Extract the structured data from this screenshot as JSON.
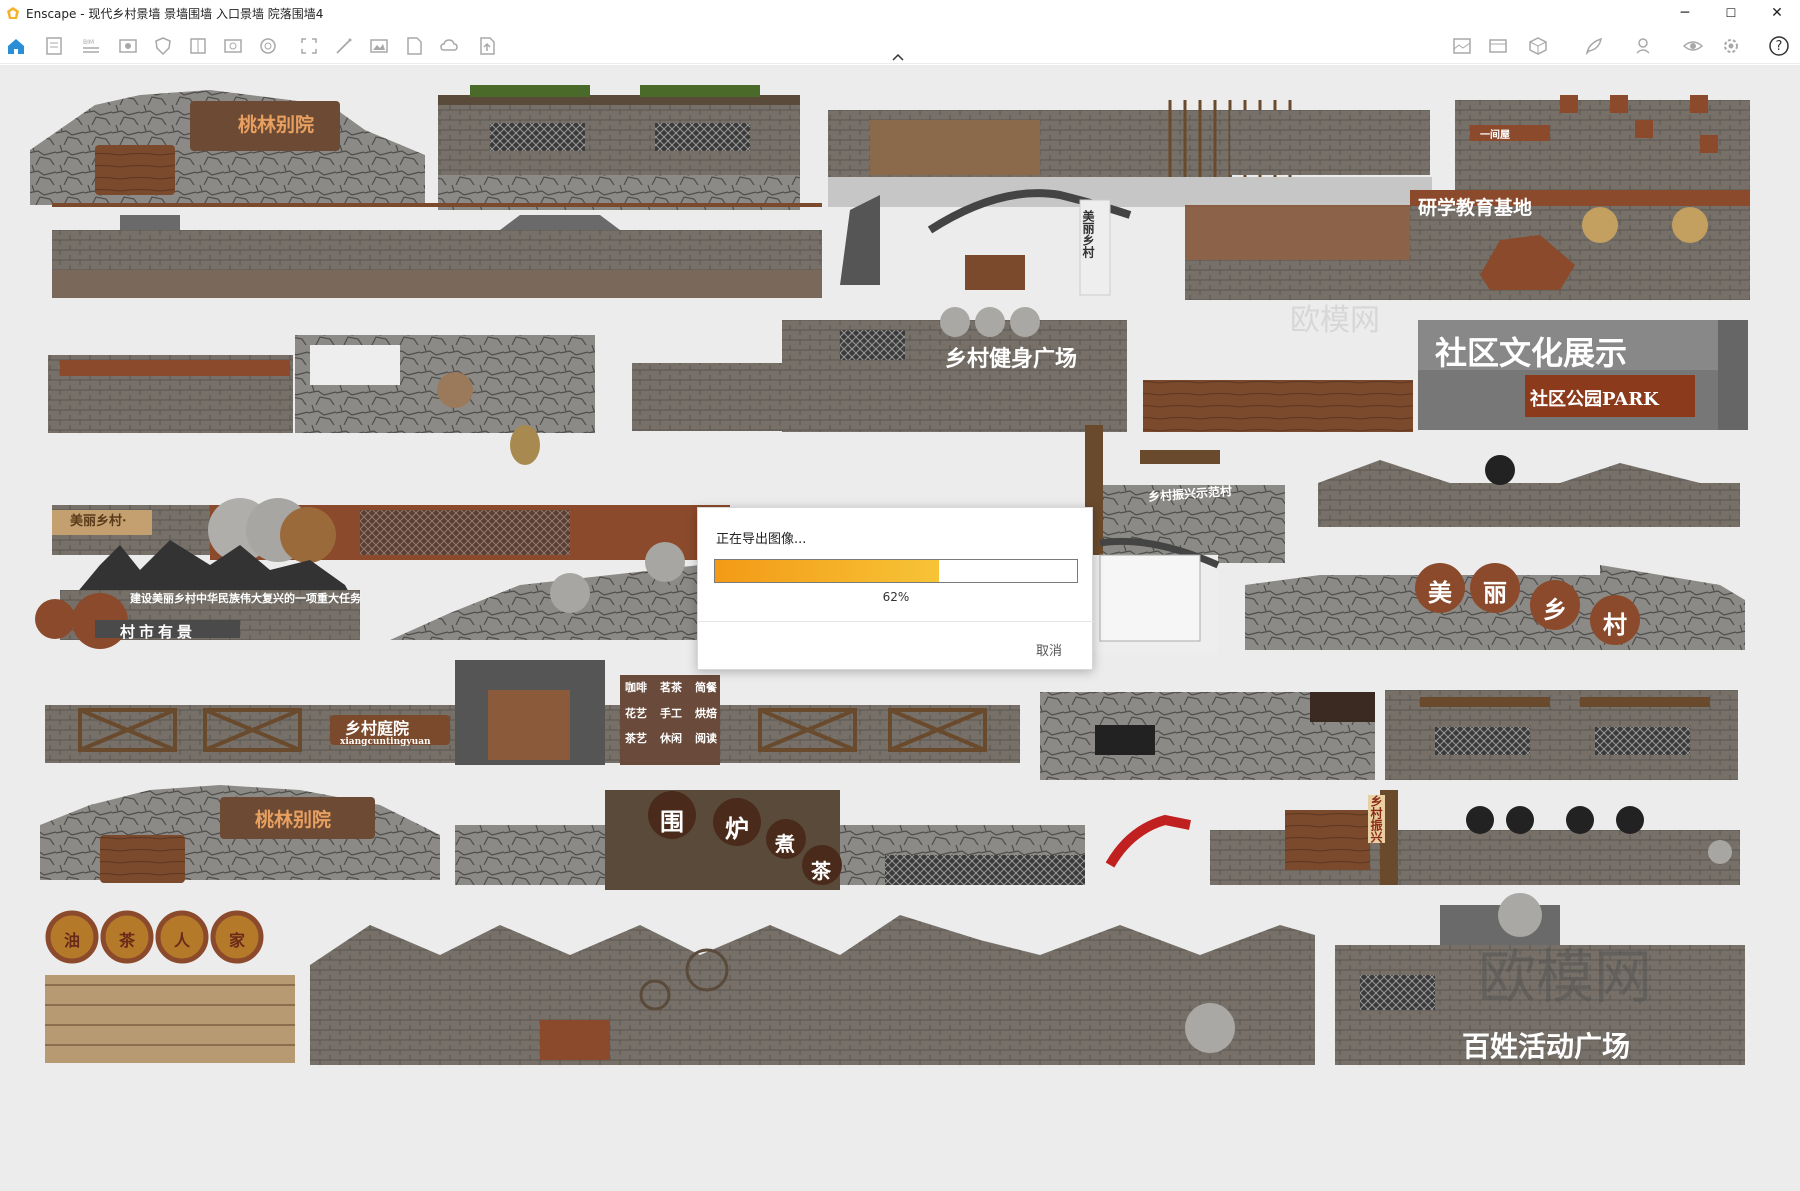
{
  "window": {
    "title": "Enscape - 现代乡村景墙 景墙围墙 入口景墙 院落围墙4",
    "controls": {
      "minimize": "─",
      "maximize": "☐",
      "close": "✕"
    }
  },
  "toolbar": {
    "left_icons": [
      "home-icon",
      "document-icon",
      "bim-icon",
      "view-icon",
      "shield-icon",
      "library-icon",
      "asset-icon",
      "material-icon",
      "capture-icon",
      "magic-icon",
      "image-icon",
      "file-icon",
      "cloud-icon",
      "upload-icon"
    ],
    "right_icons": [
      "panorama-icon",
      "gallery-icon",
      "cube-icon",
      "feather-icon",
      "link-icon",
      "eye-icon",
      "settings-icon",
      "help-icon"
    ],
    "help_label": "?"
  },
  "canvas": {
    "labels": [
      "桃林别院",
      "研学教育基地",
      "美丽乡村",
      "社区文化展示",
      "社区公园PARK",
      "乡村健身广场",
      "美丽乡村·",
      "乡村振兴示范村",
      "村市有景",
      "美",
      "丽",
      "乡",
      "村",
      "乡村庭院",
      "xiangcuntingyuan",
      "咖啡",
      "茗茶",
      "简餐",
      "花艺",
      "手工",
      "烘焙",
      "茶艺",
      "休闲",
      "阅读",
      "桃林别院",
      "围",
      "炉",
      "煮",
      "茶",
      "乡村振兴",
      "百姓活动广场",
      "油",
      "茶",
      "人",
      "家",
      "一间屋",
      "建设美丽乡村中华民族伟大复兴的一项重大任务"
    ],
    "watermark": "欧模网",
    "watermark_url": "www.om.cn"
  },
  "dialog": {
    "title": "正在导出图像...",
    "progress": 0.62,
    "progress_text": "62%",
    "cancel_label": "取消"
  },
  "colors": {
    "accent": "#f39a16",
    "canvas_bg": "#ececec",
    "brick": "#7a6e66",
    "wood": "#8b4a2b"
  }
}
